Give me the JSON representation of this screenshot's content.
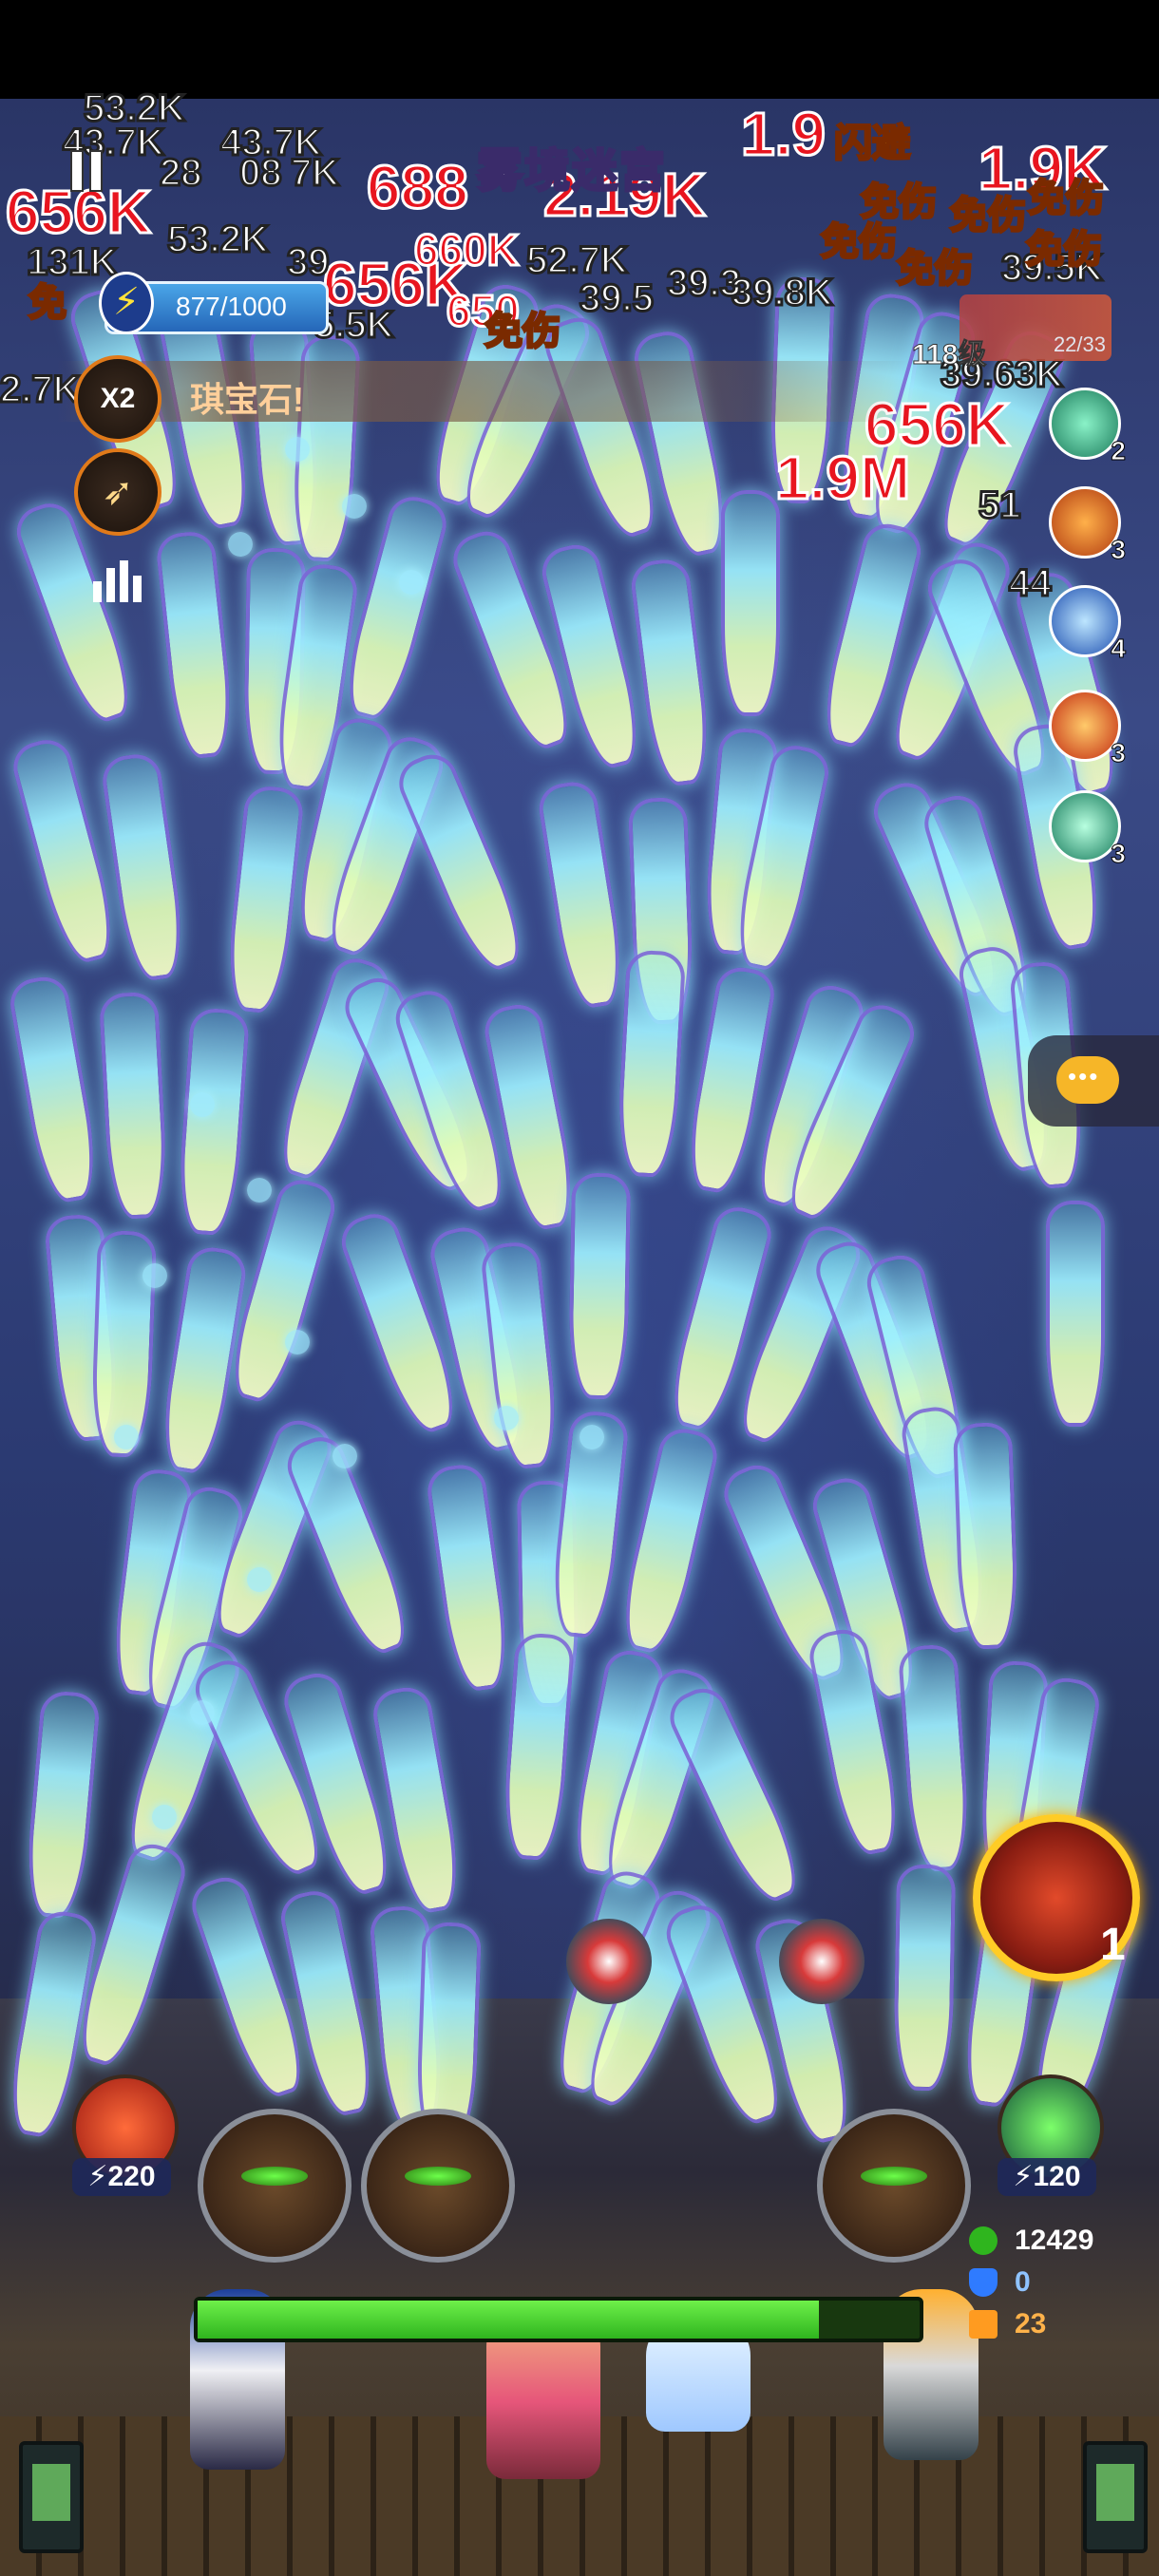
{
  "game": {
    "stage_title": "雾境迷宫",
    "energy": "877/1000",
    "hint_text": "琪宝石!",
    "speed_label": "X2",
    "boss_level": "118级",
    "boss_progress": "22/33"
  },
  "damage_numbers": {
    "red_large": [
      "656K",
      "656K",
      "1.9M",
      "656K",
      "1.9",
      "688",
      "2.19K",
      "660K",
      "650",
      "1.9K"
    ],
    "white": [
      "53.2K",
      "43.7K",
      "43.7K",
      "28",
      "08",
      "7K",
      "53.2K",
      "131K",
      "39",
      "52.7K",
      "39.5",
      "39.3",
      "39.8K",
      "39.5K",
      "39.63K",
      "2.7K",
      "51",
      "44",
      "5.5K"
    ],
    "yellow": [
      "闪避",
      "免伤",
      "免伤",
      "免伤",
      "免伤",
      "免伤",
      "免伤",
      "免伤",
      "免"
    ]
  },
  "skills": [
    {
      "name": "tornado-skill",
      "count": "2"
    },
    {
      "name": "fire-skill",
      "count": "3"
    },
    {
      "name": "ice-skill",
      "count": "4"
    },
    {
      "name": "flame-sword-skill",
      "count": "3"
    },
    {
      "name": "wind-skill",
      "count": "3"
    }
  ],
  "hero": {
    "count": "1"
  },
  "ultimates": {
    "left_cost": "220",
    "right_cost": "120"
  },
  "resources": {
    "score": "12429",
    "shield": "0",
    "coins": "23"
  },
  "base_hp_fraction": 0.86,
  "colors": {
    "damage_red": "#e8151f",
    "status_yellow": "#ffd21c",
    "hp_green": "#2fb51e",
    "fish_cyan": "#9ef0ff",
    "shield_blue": "#2f7bff",
    "coin_orange": "#ff9b20"
  }
}
